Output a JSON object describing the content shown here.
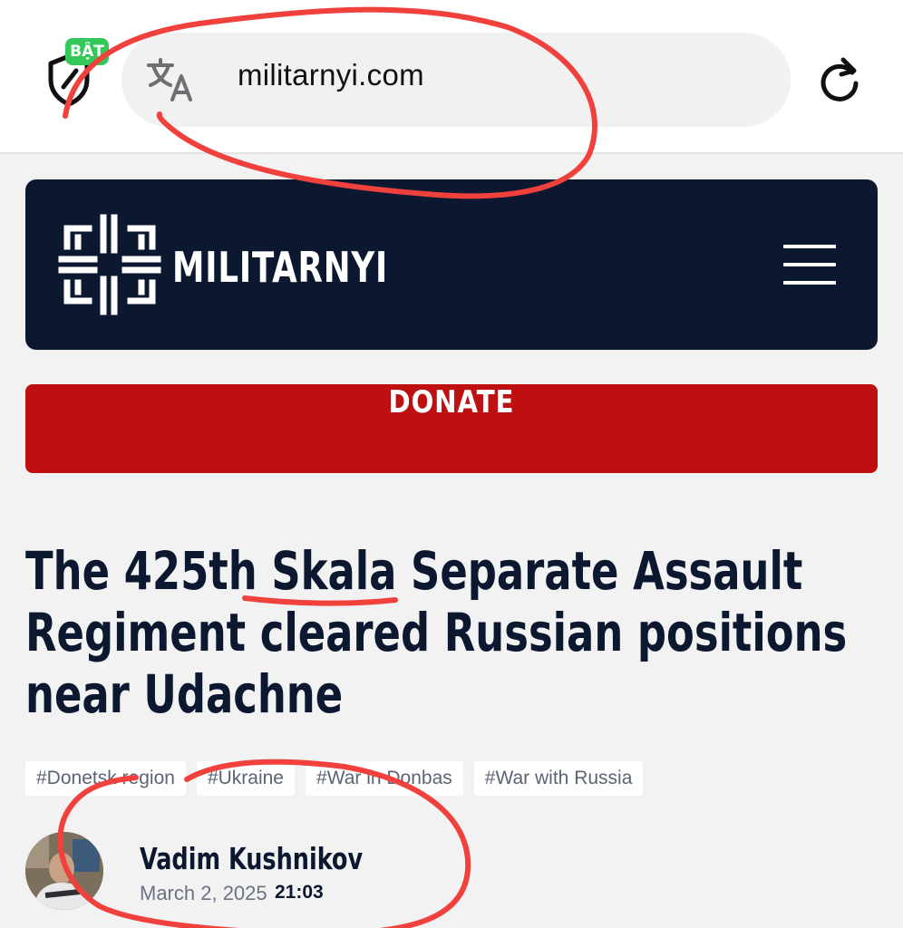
{
  "browser": {
    "badge_text": "BẬT",
    "url": "militarnyi.com",
    "shield_icon": "shield-icon",
    "translate_icon": "translate-icon",
    "reload_icon": "reload-icon"
  },
  "site": {
    "logo_text": "MILITARNYI",
    "menu_icon": "hamburger-menu-icon",
    "header_color": "#0c1830"
  },
  "donate": {
    "label": "DONATE",
    "color": "#be1010"
  },
  "article": {
    "headline_lines": [
      "The 425th Skala Separate Assault",
      "Regiment cleared Russian positions",
      "near Udachne"
    ],
    "tags": [
      "#Donetsk region",
      "#Ukraine",
      "#War in Donbas",
      "#War with Russia"
    ],
    "author": "Vadim Kushnikov",
    "date": "March 2, 2025",
    "time": "21:03"
  },
  "annotation_color": "#f0413d"
}
